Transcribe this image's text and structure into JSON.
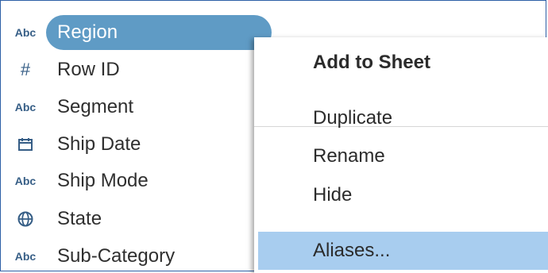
{
  "fields": [
    {
      "type_icon": "abc-icon",
      "type_text": "Abc",
      "label": "Region",
      "selected": true
    },
    {
      "type_icon": "hash-icon",
      "type_text": "#",
      "label": "Row ID"
    },
    {
      "type_icon": "abc-icon",
      "type_text": "Abc",
      "label": "Segment"
    },
    {
      "type_icon": "calendar-icon",
      "type_text": "",
      "label": "Ship Date"
    },
    {
      "type_icon": "abc-icon",
      "type_text": "Abc",
      "label": "Ship Mode"
    },
    {
      "type_icon": "globe-icon",
      "type_text": "",
      "label": "State"
    },
    {
      "type_icon": "abc-icon",
      "type_text": "Abc",
      "label": "Sub-Category"
    }
  ],
  "context_menu": {
    "items": [
      {
        "label": "Add to Sheet",
        "bold": true
      },
      {
        "label": "Duplicate"
      },
      {
        "label": "Rename"
      },
      {
        "label": "Hide"
      },
      {
        "label": "Aliases...",
        "highlighted": true
      }
    ]
  },
  "colors": {
    "selected_pill": "#5f9bc5",
    "menu_highlight": "#a8cdef",
    "icon": "#365e86",
    "frame_border": "#2e5fa6"
  }
}
